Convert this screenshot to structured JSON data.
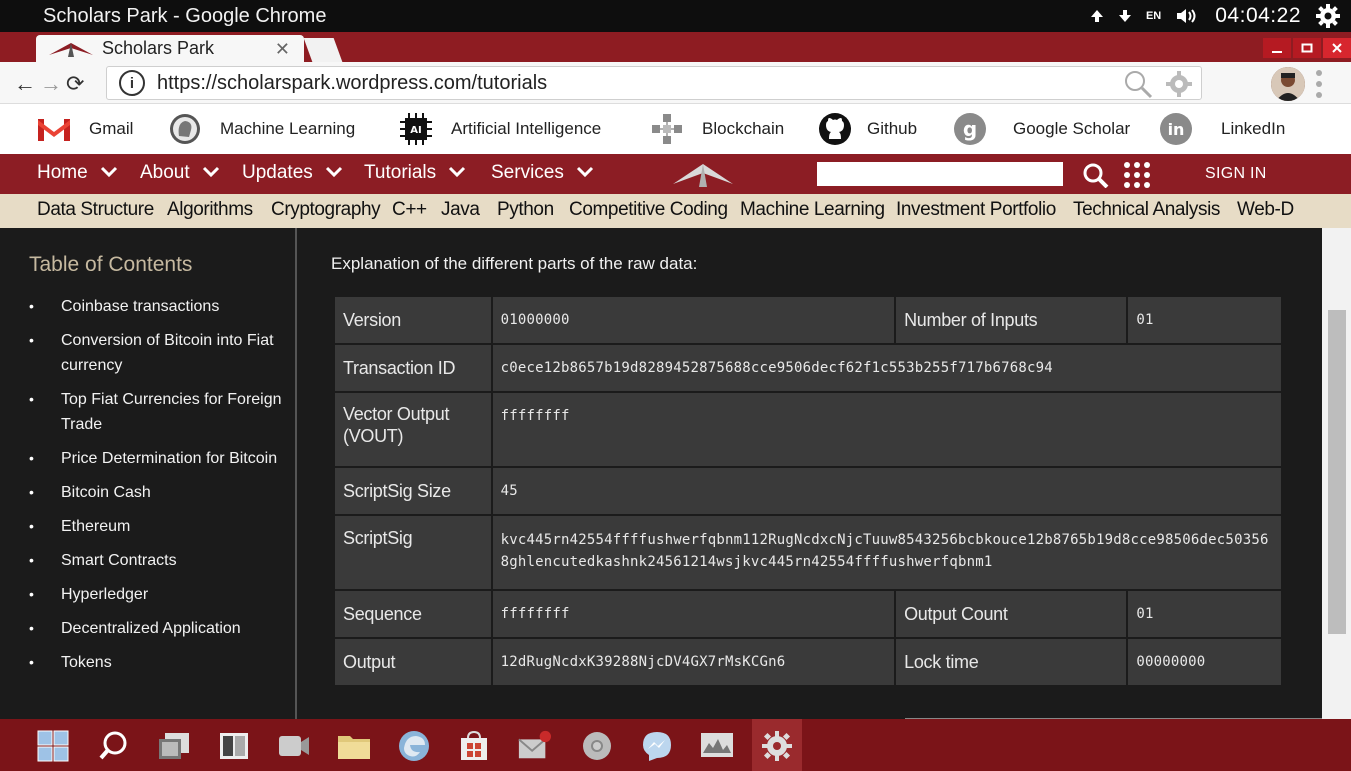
{
  "os": {
    "window_title": "Scholars Park - Google Chrome",
    "lang": "EN",
    "clock": "04:04:22"
  },
  "browser": {
    "tab_title": "Scholars Park",
    "url": "https://scholarspark.wordpress.com/tutorials"
  },
  "bookmarks": [
    {
      "label": "Gmail",
      "icon": "gmail-icon"
    },
    {
      "label": "Machine Learning",
      "icon": "machine-learning-icon"
    },
    {
      "label": "Artificial Intelligence",
      "icon": "ai-chip-icon"
    },
    {
      "label": "Blockchain",
      "icon": "blockchain-icon"
    },
    {
      "label": "Github",
      "icon": "github-icon"
    },
    {
      "label": "Google Scholar",
      "icon": "google-scholar-icon"
    },
    {
      "label": "LinkedIn",
      "icon": "linkedin-icon"
    }
  ],
  "site_nav": {
    "items": [
      "Home",
      "About",
      "Updates",
      "Tutorials",
      "Services"
    ],
    "sign_in": "SIGN IN"
  },
  "categories": [
    "Data Structure",
    "Algorithms",
    "Cryptography",
    "C++",
    "Java",
    "Python",
    "Competitive Coding",
    "Machine Learning",
    "Investment Portfolio",
    "Technical Analysis",
    "Web-D"
  ],
  "toc": {
    "title": "Table of Contents",
    "items": [
      "Coinbase transactions",
      "Conversion of Bitcoin into Fiat currency",
      "Top Fiat Currencies for Foreign Trade",
      "Price Determination for Bitcoin",
      "Bitcoin Cash",
      "Ethereum",
      "Smart Contracts",
      "Hyperledger",
      "Decentralized Application",
      "Tokens"
    ]
  },
  "main": {
    "heading": "Explanation of the different parts of the raw data:",
    "rows": {
      "version": {
        "label": "Version",
        "value": "01000000",
        "label2": "Number of Inputs",
        "value2": "01"
      },
      "txid": {
        "label": "Transaction ID",
        "value": "c0ece12b8657b19d8289452875688cce9506decf62f1c553b255f717b6768c94"
      },
      "vout": {
        "label": "Vector Output (VOUT)",
        "value": "ffffffff"
      },
      "scriptsig_size": {
        "label": "ScriptSig Size",
        "value": "45"
      },
      "scriptsig": {
        "label": "ScriptSig",
        "value": "kvc445rn42554ffffushwerfqbnm112RugNcdxcNjcTuuw8543256bcbkouce12b8765b19d8cce98506dec503568ghlencutedkashnk24561214wsjkvc445rn42554ffffushwerfqbnm1"
      },
      "sequence": {
        "label": "Sequence",
        "value": "ffffffff",
        "label2": "Output Count",
        "value2": "01"
      },
      "output": {
        "label": "Output",
        "value": "12dRugNcdxK39288NjcDV4GX7rMsKCGn6",
        "label2": "Lock time",
        "value2": "00000000"
      }
    }
  },
  "colors": {
    "brand_red": "#8c1d24",
    "category_bar": "#e7dcc6",
    "toc_title": "#c6b9a0"
  },
  "taskbar_icons": [
    "windows-start-icon",
    "search-icon",
    "screenshot-icon",
    "task-view-icon",
    "camera-icon",
    "file-explorer-icon",
    "edge-icon",
    "store-icon",
    "mail-icon",
    "chrome-icon",
    "messenger-icon",
    "monitor-icon",
    "settings-icon"
  ]
}
